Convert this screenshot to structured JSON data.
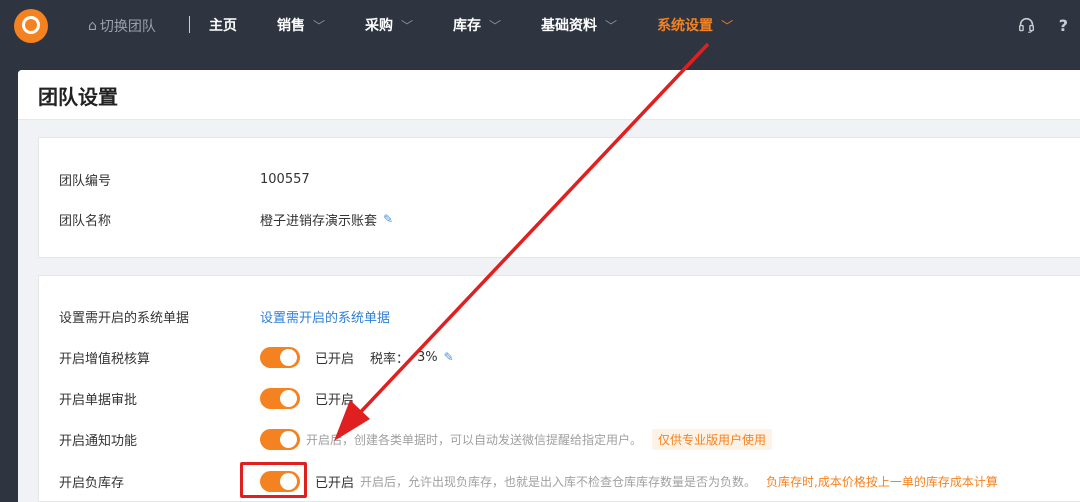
{
  "topbar": {
    "team_switch": "切换团队",
    "nav": [
      {
        "label": "主页",
        "has_dropdown": false,
        "active": false
      },
      {
        "label": "销售",
        "has_dropdown": true,
        "active": false
      },
      {
        "label": "采购",
        "has_dropdown": true,
        "active": false
      },
      {
        "label": "库存",
        "has_dropdown": true,
        "active": false
      },
      {
        "label": "基础资料",
        "has_dropdown": true,
        "active": false
      },
      {
        "label": "系统设置",
        "has_dropdown": true,
        "active": true
      }
    ],
    "help": "?"
  },
  "page": {
    "title": "团队设置"
  },
  "team_info": {
    "number_label": "团队编号",
    "number_value": "100557",
    "name_label": "团队名称",
    "name_value": "橙子进销存演示账套"
  },
  "settings": {
    "doc_label": "设置需开启的系统单据",
    "doc_link": "设置需开启的系统单据",
    "vat_label": "开启增值税核算",
    "vat_status": "已开启",
    "vat_rate_label": "税率：",
    "vat_rate_value": "3%",
    "approval_label": "开启单据审批",
    "approval_status": "已开启",
    "notify_label": "开启通知功能",
    "notify_hint": "开启后，创建各类单据时，可以自动发送微信提醒给指定用户。",
    "notify_badge": "仅供专业版用户使用",
    "neg_label": "开启负库存",
    "neg_status": "已开启",
    "neg_hint": "开启后，允许出现负库存，也就是出入库不检查仓库库存数量是否为负数。",
    "neg_warn": "负库存时,成本价格按上一单的库存成本计算"
  },
  "colors": {
    "accent": "#f58220",
    "annotation": "#e02020",
    "link": "#2f7fd8",
    "nav_bg": "#2f3441"
  }
}
